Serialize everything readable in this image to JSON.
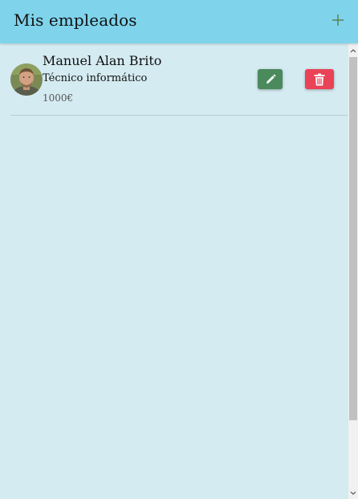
{
  "toolbar": {
    "title": "Mis empleados",
    "add_icon": "plus-icon"
  },
  "employees": [
    {
      "name": "Manuel Alan Brito",
      "role": "Técnico informático",
      "salary": "1000€",
      "edit_icon": "pencil-icon",
      "delete_icon": "trash-icon"
    }
  ],
  "colors": {
    "toolbar_bg": "#7fd4ec",
    "content_bg": "#d4ebf1",
    "edit_button": "#4a8a5c",
    "delete_button": "#ea4257",
    "add_icon": "#5c7a4c"
  }
}
